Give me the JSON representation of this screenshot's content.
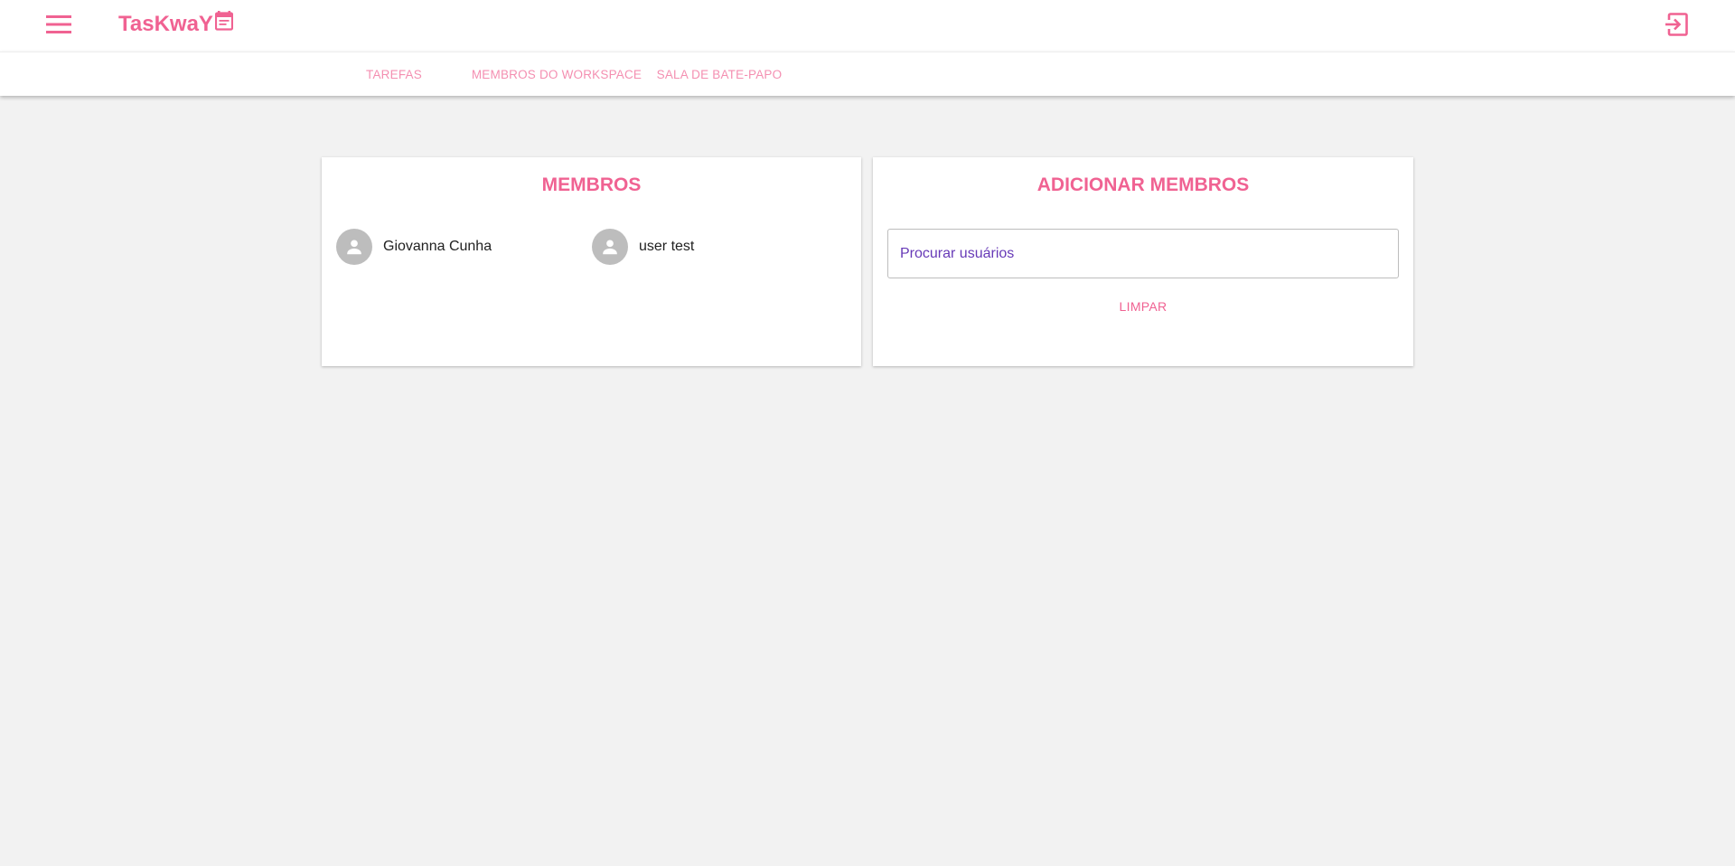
{
  "app": {
    "brand": "TasKwaY",
    "brand_icon": "calendar-note-icon",
    "accent_color": "#f06292",
    "menu_icon": "menu-icon",
    "logout_icon": "logout-icon"
  },
  "tabs": [
    {
      "label": "TAREFAS"
    },
    {
      "label": "MEMBROS DO WORKSPACE"
    },
    {
      "label": "SALA DE BATE-PAPO"
    }
  ],
  "members_card": {
    "title": "MEMBROS",
    "members": [
      {
        "name": "Giovanna Cunha",
        "avatar_icon": "person-icon"
      },
      {
        "name": "user test",
        "avatar_icon": "person-icon"
      }
    ]
  },
  "add_members_card": {
    "title": "ADICIONAR MEMBROS",
    "search_placeholder": "Procurar usuários",
    "search_value": "",
    "clear_label": "LIMPAR"
  }
}
